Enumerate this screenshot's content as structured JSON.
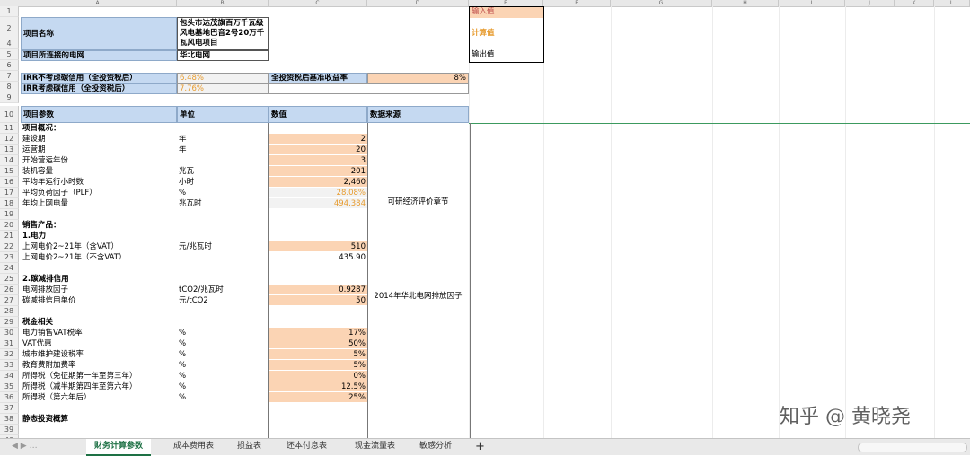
{
  "columns": [
    "A",
    "B",
    "C",
    "D",
    "E",
    "F",
    "G",
    "H",
    "I",
    "J",
    "K",
    "L"
  ],
  "legend": {
    "input": "输入值",
    "calc": "计算值",
    "output": "输出值"
  },
  "project": {
    "name_label": "项目名称",
    "name_value": "包头市达茂旗百万千瓦级风电基地巴音2号20万千瓦风电项目",
    "grid_label": "项目所连接的电网",
    "grid_value": "华北电网"
  },
  "irr": {
    "no_carbon_label": "IRR不考虑碳信用（全投资税后）",
    "no_carbon_value": "6.48%",
    "benchmark_label": "全投资税后基准收益率",
    "benchmark_value": "8%",
    "with_carbon_label": "IRR考虑碳信用（全投资税后）",
    "with_carbon_value": "7.76%"
  },
  "table_header": {
    "param": "项目参数",
    "unit": "单位",
    "value": "数值",
    "source": "数据来源"
  },
  "rows": [
    {
      "r": 11,
      "a": "项目概况：",
      "bold": true
    },
    {
      "r": 12,
      "a": "建设期",
      "b": "年",
      "c": "2",
      "style": "in"
    },
    {
      "r": 13,
      "a": "运营期",
      "b": "年",
      "c": "20",
      "style": "in"
    },
    {
      "r": 14,
      "a": "开始营运年份",
      "c": "3",
      "style": "in"
    },
    {
      "r": 15,
      "a": "装机容量",
      "b": "兆瓦",
      "c": "201",
      "style": "in"
    },
    {
      "r": 16,
      "a": "平均年运行小时数",
      "b": "小时",
      "c": "2,460",
      "style": "in"
    },
    {
      "r": 17,
      "a": "平均负荷因子（PLF）",
      "b": "%",
      "c": "28.08%",
      "style": "calc"
    },
    {
      "r": 18,
      "a": "年均上网电量",
      "b": "兆瓦时",
      "c": "494,384",
      "style": "calc"
    },
    {
      "r": 20,
      "a": "销售产品：",
      "bold": true
    },
    {
      "r": 21,
      "a": "1.电力",
      "bold": true
    },
    {
      "r": 22,
      "a": "上网电价2~21年（含VAT）",
      "b": "元/兆瓦时",
      "c": "510",
      "style": "in"
    },
    {
      "r": 23,
      "a": "上网电价2~21年（不含VAT）",
      "c": "435.90",
      "style": "calcplain"
    },
    {
      "r": 25,
      "a": "2.碳减排信用",
      "bold": true
    },
    {
      "r": 26,
      "a": "电网排放因子",
      "b": "tCO2/兆瓦时",
      "c": "0.9287",
      "style": "in"
    },
    {
      "r": 27,
      "a": "碳减排信用单价",
      "b": "元/tCO2",
      "c": "50",
      "style": "in"
    },
    {
      "r": 29,
      "a": "税金相关",
      "bold": true
    },
    {
      "r": 30,
      "a": "电力销售VAT税率",
      "b": "%",
      "c": "17%",
      "style": "in"
    },
    {
      "r": 31,
      "a": "VAT优惠",
      "b": "%",
      "c": "50%",
      "style": "in"
    },
    {
      "r": 32,
      "a": "城市维护建设税率",
      "b": "%",
      "c": "5%",
      "style": "in"
    },
    {
      "r": 33,
      "a": "教育费附加费率",
      "b": "%",
      "c": "5%",
      "style": "in"
    },
    {
      "r": 34,
      "a": "所得税（免征期第一年至第三年）",
      "b": "%",
      "c": "0%",
      "style": "in"
    },
    {
      "r": 35,
      "a": "所得税（减半期第四年至第六年）",
      "b": "%",
      "c": "12.5%",
      "style": "in"
    },
    {
      "r": 36,
      "a": "所得税（第六年后）",
      "b": "%",
      "c": "25%",
      "style": "in"
    },
    {
      "r": 38,
      "a": "静态投资概算",
      "bold": true
    }
  ],
  "sources": {
    "feasibility": "可研经济评价章节",
    "grid_factor": "2014年华北电网排放因子"
  },
  "tabs": [
    "财务计算参数",
    "成本费用表",
    "损益表",
    "还本付息表",
    "现金流量表",
    "敏感分析"
  ],
  "active_tab": 0,
  "add_tab": "+",
  "watermark": "知乎 @ 黄晓尧",
  "colors": {
    "header_fill": "#c5d9f1",
    "input_fill": "#fbd4b4",
    "calc_text": "#e79b2e",
    "tab_active": "#1e7145"
  }
}
